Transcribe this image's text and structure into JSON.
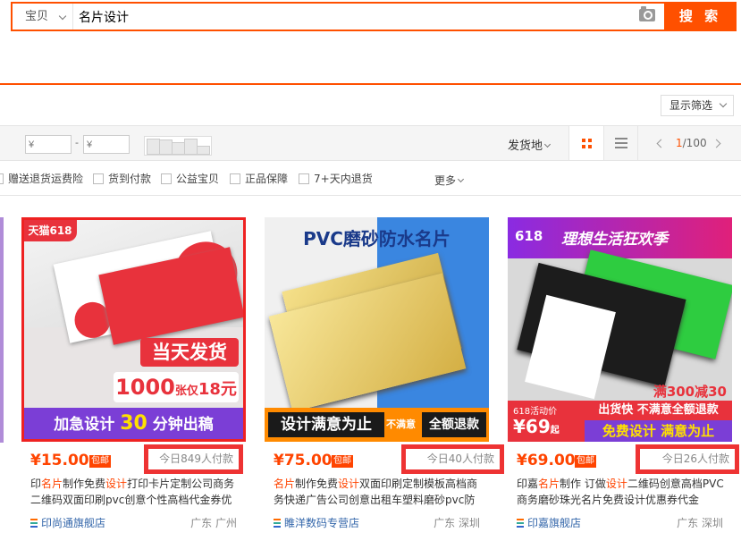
{
  "search": {
    "scope_label": "宝贝",
    "query": "名片设计",
    "button_label": "搜 索"
  },
  "filter_button": "显示筛选",
  "sortbar": {
    "price_min_placeholder": "¥",
    "price_max_placeholder": "¥",
    "dash": "-",
    "origin_label": "发货地",
    "page_current": "1",
    "page_total": "/100"
  },
  "checkboxes": [
    "赠送退货运费险",
    "货到付款",
    "公益宝贝",
    "正品保障",
    "7+天内退货"
  ],
  "more_label": "更多",
  "colors": {
    "accent": "#ff5000",
    "price": "#ff4400",
    "highlight_border": "#ee3333"
  },
  "products": [
    {
      "price": "¥15.00",
      "free_shipping": "包邮",
      "paid_today": "今日849人付款",
      "title_segments": [
        "印",
        "名片",
        "制作免费",
        "设计",
        "打印卡片定制公司商务二维码双面印刷pvc创意个性高档代金券优"
      ],
      "shop": "印尚通旗舰店",
      "location": "广东 广州",
      "image": {
        "corner_tag": "天猫618",
        "banner_1": "当天发货",
        "banner_2_big": "1000",
        "banner_2_small": "张仅",
        "banner_2_price": "18元",
        "banner_3_prefix": "加急设计",
        "banner_3_num": "30",
        "banner_3_suffix": "分钟出稿"
      }
    },
    {
      "price": "¥75.00",
      "free_shipping": "包邮",
      "paid_today": "今日40人付款",
      "title_segments": [
        "",
        "名片",
        "制作免费",
        "设计",
        "双面印刷定制模板高档商务快递广告公司创意出租车塑料磨砂pvc防"
      ],
      "shop": "睢洋数码专营店",
      "location": "广东 深圳",
      "image": {
        "header_a": "PVC磨砂",
        "header_b": "防水名片",
        "banner_1": "设计满意为止",
        "banner_2": "不满意",
        "banner_3": "全额退款"
      }
    },
    {
      "price": "¥69.00",
      "free_shipping": "包邮",
      "paid_today": "今日26人付款",
      "title_segments": [
        "印嘉",
        "名片",
        "制作 订做",
        "设计",
        "二维码创意高档PVC商务磨砂珠光名片免费设计优惠券代金"
      ],
      "shop": "印嘉旗舰店",
      "location": "广东 深圳",
      "image": {
        "top_tag": "618",
        "top_banner": "理想生活狂欢季",
        "promo": "满300减30",
        "event_label": "618活动价",
        "event_price": "¥69",
        "event_suffix": "起",
        "banner_1": "出货快 不满意全额退款",
        "banner_2": "免费设计 满意为止"
      }
    }
  ]
}
